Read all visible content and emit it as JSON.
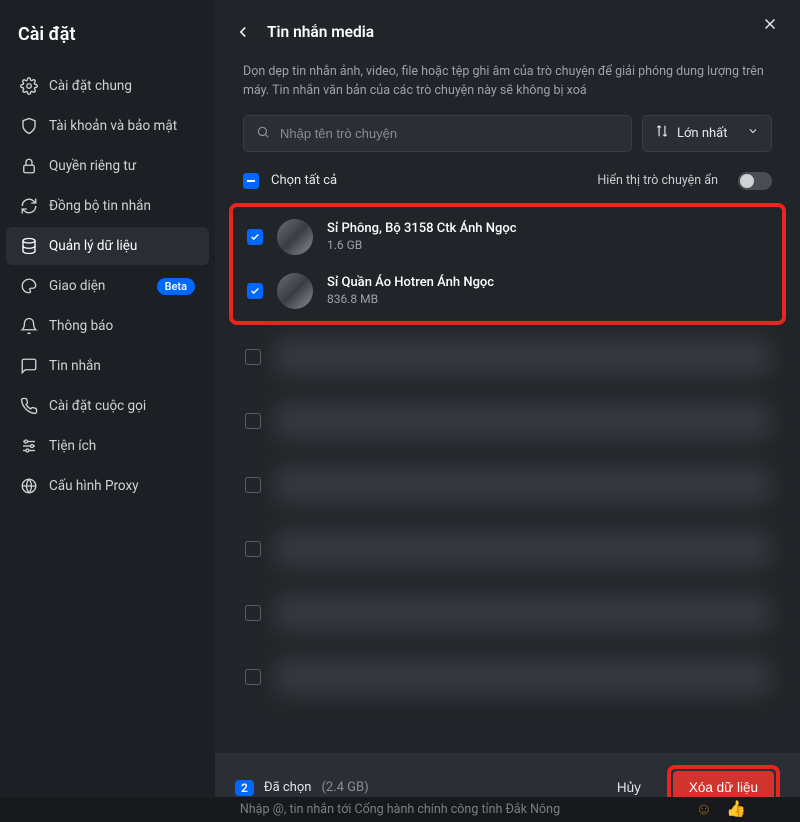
{
  "sidebar": {
    "title": "Cài đặt",
    "items": [
      {
        "label": "Cài đặt chung"
      },
      {
        "label": "Tài khoản và bảo mật"
      },
      {
        "label": "Quyền riêng tư"
      },
      {
        "label": "Đồng bộ tin nhắn"
      },
      {
        "label": "Quản lý dữ liệu"
      },
      {
        "label": "Giao diện",
        "badge": "Beta"
      },
      {
        "label": "Thông báo"
      },
      {
        "label": "Tin nhắn"
      },
      {
        "label": "Cài đặt cuộc gọi"
      },
      {
        "label": "Tiện ích"
      },
      {
        "label": "Cấu hình Proxy"
      }
    ]
  },
  "header": {
    "title": "Tin nhắn media"
  },
  "description": "Dọn dẹp tin nhắn ảnh, video, file hoặc tệp ghi âm của trò chuyện để giải phóng dung lượng trên máy. Tin nhắn văn bản của các trò chuyện này sẽ không bị xoá",
  "search": {
    "placeholder": "Nhập tên trò chuyện"
  },
  "sort": {
    "label": "Lớn nhất"
  },
  "selectAll": {
    "label": "Chọn tất cả",
    "hiddenLabel": "Hiển thị trò chuyện ẩn"
  },
  "conversations": [
    {
      "name": "Sỉ Phông, Bộ 3158 Ctk Ánh Ngọc",
      "size": "1.6 GB"
    },
    {
      "name": "Sỉ Quần Áo Hotren Ánh Ngọc",
      "size": "836.8 MB"
    }
  ],
  "footer": {
    "count": "2",
    "selectedLabel": "Đã chọn",
    "totalSize": "(2.4 GB)",
    "cancelLabel": "Hủy",
    "deleteLabel": "Xóa dữ liệu"
  },
  "bottomHint": "Nhập @, tin nhắn tới Cổng hành chính công tỉnh Đắk Nông"
}
